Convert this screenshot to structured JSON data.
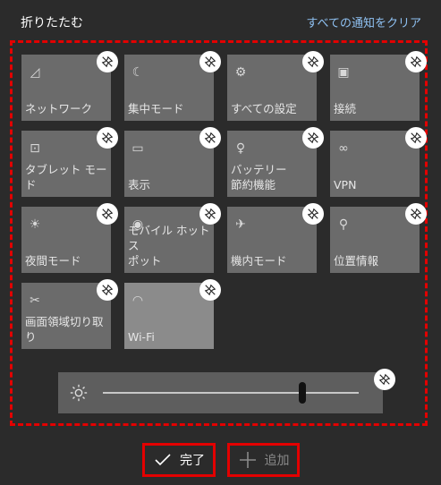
{
  "header": {
    "collapse_label": "折りたたむ",
    "clear_all_label": "すべての通知をクリア"
  },
  "tiles": [
    {
      "label": "ネットワーク",
      "icon": "network-icon",
      "on": false
    },
    {
      "label": "集中モード",
      "icon": "moon-icon",
      "on": false
    },
    {
      "label": "すべての設定",
      "icon": "gear-icon",
      "on": false
    },
    {
      "label": "接続",
      "icon": "connect-icon",
      "on": false
    },
    {
      "label": "タブレット モード",
      "icon": "tablet-mode-icon",
      "on": false
    },
    {
      "label": "表示",
      "icon": "project-icon",
      "on": false
    },
    {
      "label": "バッテリー\n節約機能",
      "icon": "battery-saver-icon",
      "on": false
    },
    {
      "label": "VPN",
      "icon": "vpn-icon",
      "on": false
    },
    {
      "label": "夜間モード",
      "icon": "night-light-icon",
      "on": false
    },
    {
      "label": "モバイル ホットス\nポット",
      "icon": "hotspot-icon",
      "on": false
    },
    {
      "label": "機内モード",
      "icon": "airplane-icon",
      "on": false
    },
    {
      "label": "位置情報",
      "icon": "location-icon",
      "on": false
    },
    {
      "label": "画面領域切り取\nり",
      "icon": "snip-icon",
      "on": false
    },
    {
      "label": "Wi-Fi",
      "icon": "wifi-icon",
      "on": true
    }
  ],
  "brightness": {
    "level": 0.78
  },
  "footer": {
    "done_label": "完了",
    "add_label": "追加"
  },
  "colors": {
    "accent_red": "#e30000",
    "link_blue": "#8fc1f2",
    "tile": "#6b6b6b",
    "tile_on": "#8b8b8b"
  }
}
